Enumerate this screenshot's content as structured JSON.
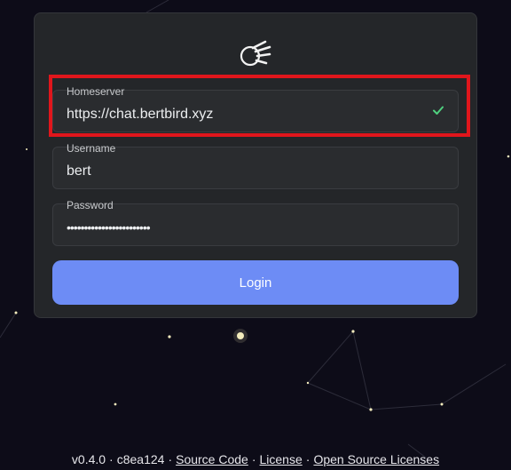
{
  "login_form": {
    "homeserver": {
      "label": "Homeserver",
      "value": "https://chat.bertbird.xyz",
      "status_icon": "check-icon",
      "status_color": "#4fd17f"
    },
    "username": {
      "label": "Username",
      "value": "bert"
    },
    "password": {
      "label": "Password",
      "value": "••••••••••••••••••••••••"
    },
    "login_button": "Login",
    "logo_icon": "comet-logo-icon",
    "accent_color": "#6d8cf5",
    "highlight_color": "#e0161c"
  },
  "footer": {
    "version": "v0.4.0",
    "commit": "c8ea124",
    "separator": "·",
    "links": [
      "Source Code",
      "License",
      "Open Source Licenses"
    ]
  }
}
